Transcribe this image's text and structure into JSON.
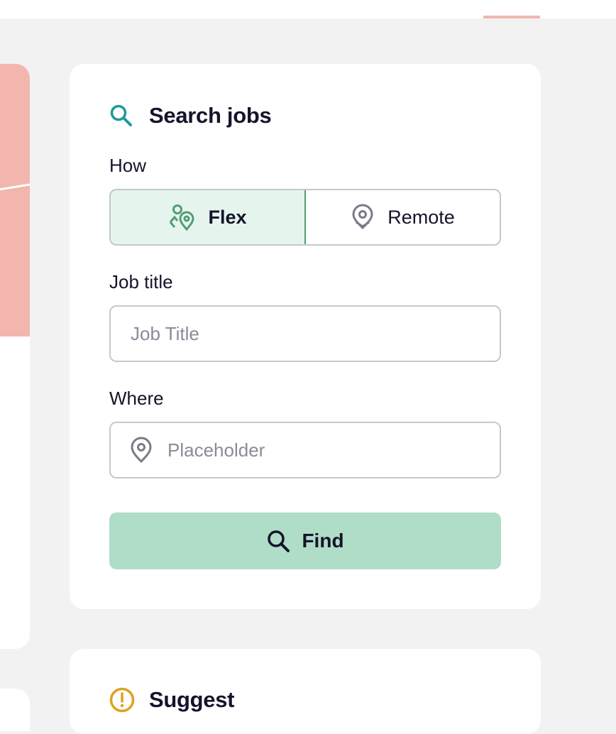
{
  "colors": {
    "background": "#f2f2f3",
    "card": "#ffffff",
    "accent_teal": "#1a9a9a",
    "flex_green": "#4f9e72",
    "flex_bg": "#e6f4ee",
    "find_button": "#b0ddc8",
    "suggest_warning": "#e0a020",
    "hero_pink": "#f2b6ae",
    "text": "#14142b",
    "placeholder": "#8a8b99"
  },
  "search_card": {
    "title": "Search jobs",
    "title_icon": "search-icon",
    "how": {
      "label": "How",
      "options": [
        {
          "label": "Flex",
          "icon": "flex-location-icon",
          "selected": true
        },
        {
          "label": "Remote",
          "icon": "remote-location-icon",
          "selected": false
        }
      ]
    },
    "job_title": {
      "label": "Job title",
      "placeholder": "Job Title",
      "value": ""
    },
    "where": {
      "label": "Where",
      "placeholder": "Placeholder",
      "icon": "location-pin-icon",
      "value": ""
    },
    "find_button": {
      "label": "Find",
      "icon": "search-icon"
    }
  },
  "suggest_card": {
    "title": "Suggest",
    "title_icon": "warning-icon"
  }
}
